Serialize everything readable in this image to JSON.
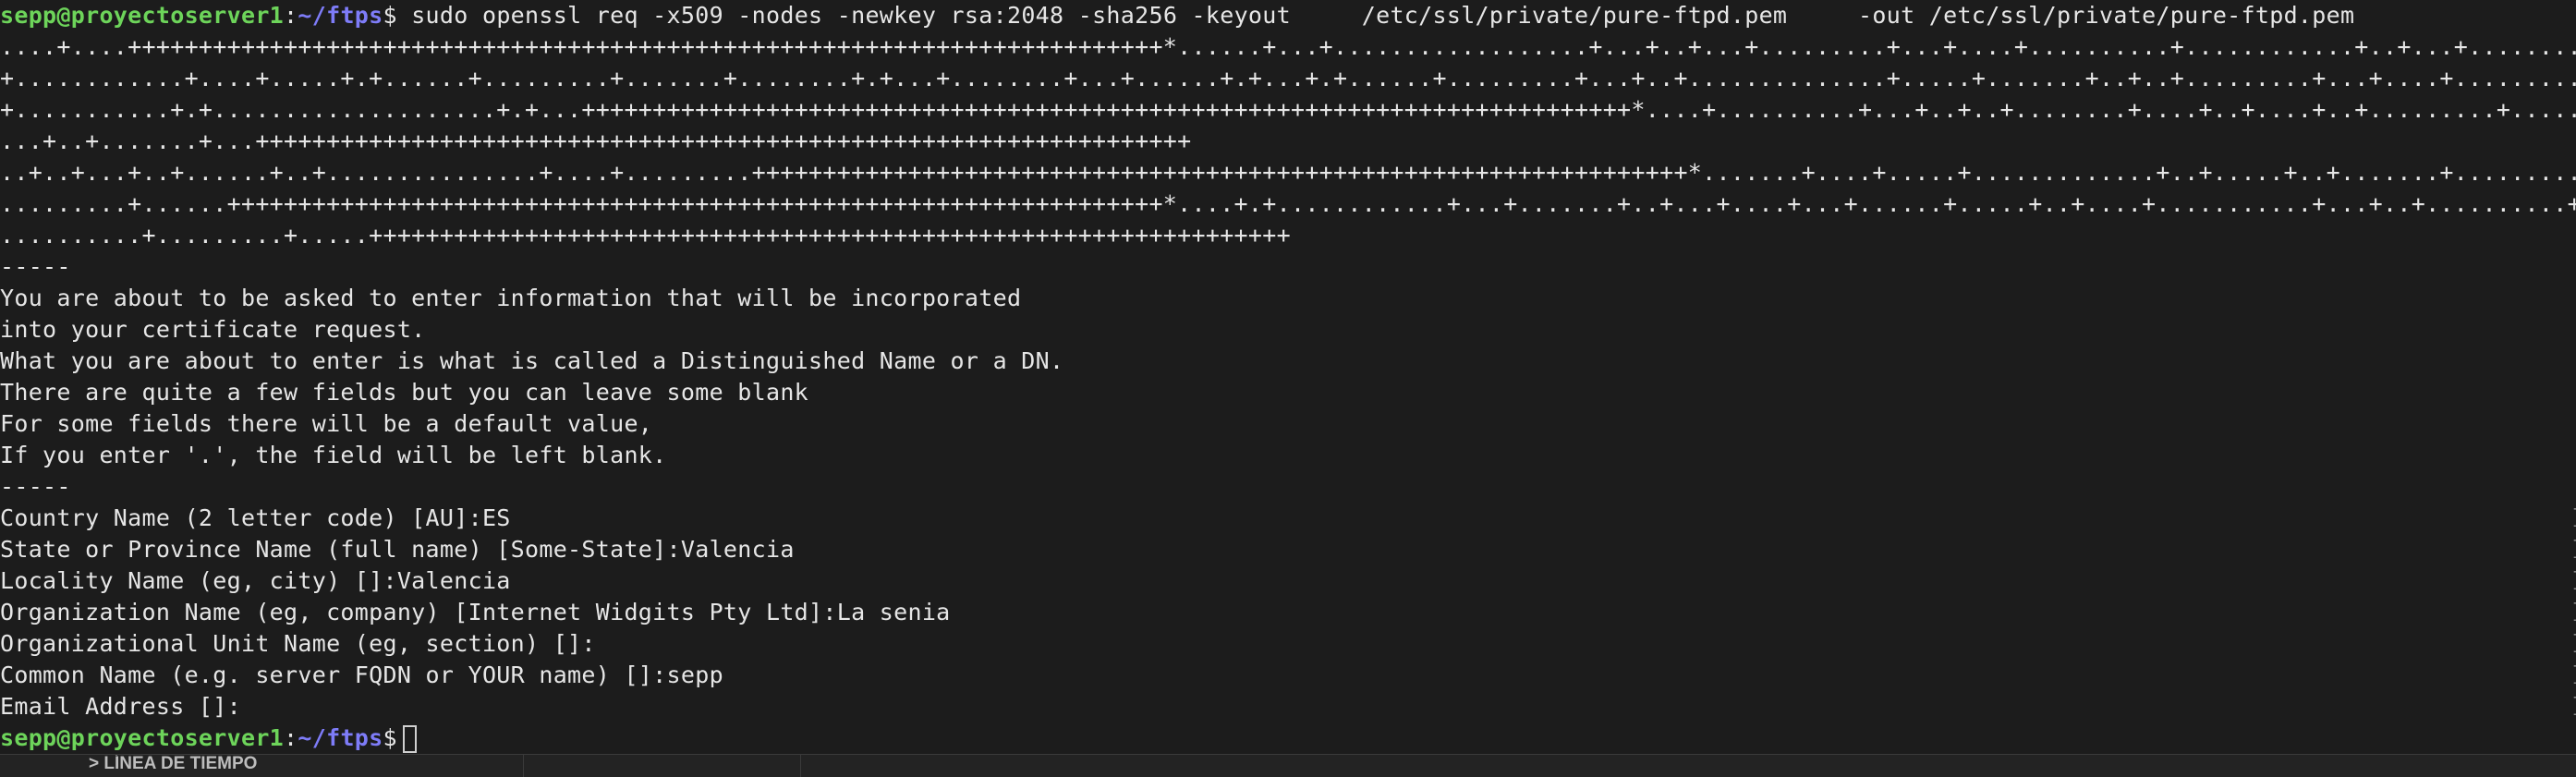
{
  "terminal": {
    "prompt": {
      "user_host": "sepp@proyectoserver1",
      "colon": ":",
      "path": "~/ftps",
      "dollar": "$"
    },
    "command": " sudo openssl req -x509 -nodes -newkey rsa:2048 -sha256 -keyout     /etc/ssl/private/pure-ftpd.pem     -out /etc/ssl/private/pure-ftpd.pem",
    "keygen_lines": [
      "....+....+++++++++++++++++++++++++++++++++++++++++++++++++++++++++++++++++++++++++*......+...+..................+...+..+...+.........+...+....+..........+............+..+...+..........",
      "+............+....+.....+.+......+.........+.......+........+.+...+........+...+......+.+...+.+......+.........+...+..+..............+.....+.......+..+..+.........+...+....+..........",
      "+...........+.+....................+.+...++++++++++++++++++++++++++++++++++++++++++++++++++++++++++++++++++++++++++*....+..........+...+..+..+........+....+..+....+..+.........+......",
      "...+..+.......+...++++++++++++++++++++++++++++++++++++++++++++++++++++++++++++++++++",
      "..+..+...+..+......+..+...............+....+.........++++++++++++++++++++++++++++++++++++++++++++++++++++++++++++++++++*.......+....+.....+.............+..+.....+..+.......+..........",
      ".........+......++++++++++++++++++++++++++++++++++++++++++++++++++++++++++++++++++*....+.+............+...+.......+..+...+....+...+......+.....+..+....+...........+...+..+..........+...",
      "..........+.........+.....+++++++++++++++++++++++++++++++++++++++++++++++++++++++++++++++++"
    ],
    "separator": "-----",
    "info_lines": [
      "You are about to be asked to enter information that will be incorporated",
      "into your certificate request.",
      "What you are about to enter is what is called a Distinguished Name or a DN.",
      "There are quite a few fields but you can leave some blank",
      "For some fields there will be a default value,",
      "If you enter '.', the field will be left blank."
    ],
    "separator2": "-----",
    "dn_fields": [
      "Country Name (2 letter code) [AU]:ES",
      "State or Province Name (full name) [Some-State]:Valencia",
      "Locality Name (eg, city) []:Valencia",
      "Organization Name (eg, company) [Internet Widgits Pty Ltd]:La senia",
      "Organizational Unit Name (eg, section) []:",
      "Common Name (e.g. server FQDN or YOUR name) []:sepp",
      "Email Address []:"
    ],
    "final_prompt": {
      "user_host": "sepp@proyectoserver1",
      "colon": ":",
      "path": "~/ftps",
      "dollar": "$"
    }
  },
  "bottom_panel": {
    "tab_label": "> LÍNEA DE TIEMPO"
  },
  "colors": {
    "background": "#1c1c1c",
    "text": "#e6e6e6",
    "prompt_user": "#6dd45a",
    "prompt_path": "#7e7cf8"
  }
}
